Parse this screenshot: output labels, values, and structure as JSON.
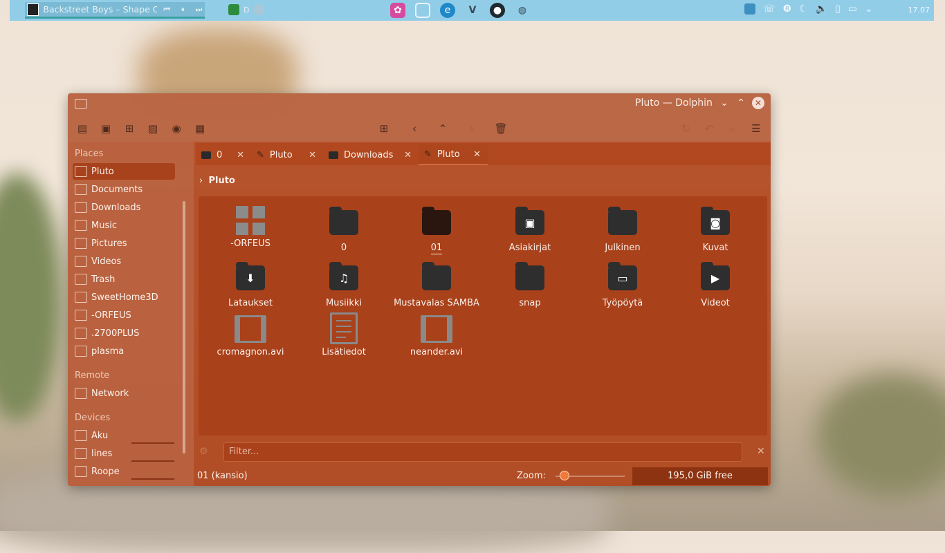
{
  "panel": {
    "media_title": "Backstreet Boys – Shape Of M...",
    "prev_icon": "⏮",
    "pause_icon": "⏸",
    "next_icon": "⏭",
    "tray_text": "D",
    "clock": "17.07"
  },
  "window": {
    "title": "Pluto — Dolphin"
  },
  "sidebar": {
    "places_header": "Places",
    "places": [
      "Pluto",
      "Documents",
      "Downloads",
      "Music",
      "Pictures",
      "Videos",
      "Trash",
      "SweetHome3D",
      "-ORFEUS",
      ".2700PLUS",
      "plasma"
    ],
    "remote_header": "Remote",
    "remote": [
      "Network"
    ],
    "devices_header": "Devices",
    "devices": [
      "Aku",
      "lines",
      "Roope"
    ]
  },
  "tabs": [
    {
      "label": "0"
    },
    {
      "label": "Pluto"
    },
    {
      "label": "Downloads"
    },
    {
      "label": "Pluto"
    }
  ],
  "breadcrumb": "Pluto",
  "files": [
    {
      "name": "-ORFEUS",
      "icon": "grid-icon"
    },
    {
      "name": "0",
      "icon": "folder-icon"
    },
    {
      "name": "01",
      "icon": "folder-icon"
    },
    {
      "name": "Asiakirjat",
      "icon": "documents-folder-icon"
    },
    {
      "name": "Julkinen",
      "icon": "folder-icon"
    },
    {
      "name": "Kuvat",
      "icon": "pictures-folder-icon"
    },
    {
      "name": "Lataukset",
      "icon": "downloads-folder-icon"
    },
    {
      "name": "Musiikki",
      "icon": "music-folder-icon"
    },
    {
      "name": "Mustavalas SAMBA",
      "icon": "folder-icon"
    },
    {
      "name": "snap",
      "icon": "folder-icon"
    },
    {
      "name": "Työpöytä",
      "icon": "desktop-folder-icon"
    },
    {
      "name": "Videot",
      "icon": "videos-folder-icon"
    },
    {
      "name": "cromagnon.avi",
      "icon": "video-file-icon"
    },
    {
      "name": "Lisätiedot",
      "icon": "text-file-icon"
    },
    {
      "name": "neander.avi",
      "icon": "video-file-icon"
    }
  ],
  "filter_placeholder": "Filter...",
  "status": {
    "selection": "01 (kansio)",
    "zoom_label": "Zoom:",
    "free_space": "195,0 GiB free"
  },
  "colors": {
    "accent": "#a9411b",
    "panel": "#92cde8"
  }
}
